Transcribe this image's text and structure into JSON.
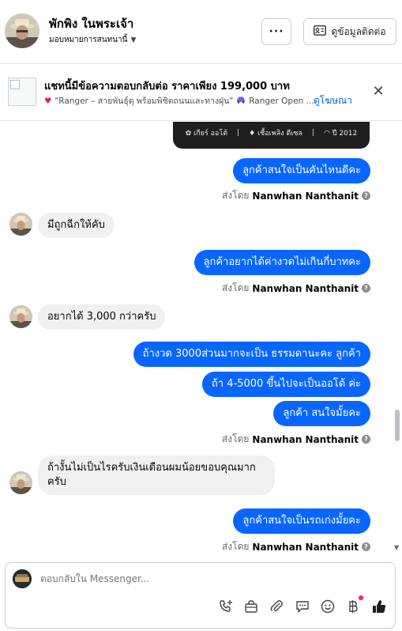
{
  "header": {
    "contact_name": "พักพิง ในพระเจ้า",
    "assign_label": "มอบหมายการสนทนานี้",
    "more_label": "···",
    "contact_info_label": "ดูข้อมูลติดต่อ"
  },
  "ad": {
    "title": "แชทนี้มีข้อความตอบกลับต่อ ราคาเพียง 199,000 บาท",
    "subtitle_a": "\"Ranger – สายพันธุ์ดุ พร้อมพิชิตถนนและทางฝุ่น\"",
    "subtitle_b": "Ranger Open ...",
    "view_ad": "ดูโฆษณา",
    "close": "✕"
  },
  "card": {
    "gear": "เกียร์ ออโต้",
    "fuel": "เชื้อเพลิง ดีเซล",
    "year": "ปี 2012"
  },
  "messages": {
    "m1": "ลูกค้าสนใจเป็นคันไหนดีคะ",
    "m2": "มีถูกฉีกให้คับ",
    "m3": "ลูกค้าอยากได้ค่างวดไม่เกินกี่บาทคะ",
    "m4": "อยากได้ 3,000 กว่าครับ",
    "m5": "ถ้างวด 3000ส่วนมากจะเป็น ธรรมดานะคะ  ลูกค้า",
    "m6": "ถ้า 4-5000 ขึ้นไปจะเป็นออโต้ ค่ะ",
    "m7": "ลูกค้า สนใจมั้ยคะ",
    "m8_line1": "ถ้างั้นไม่เป็นไรครับเงินเดือนผมน้อยขอบคุณมาก",
    "m8_line2": "ครับ",
    "m9": "ลูกค้าสนใจเป็นรถเก่งมั้ยคะ"
  },
  "sent_by": {
    "prefix": "ส่งโดย",
    "agent": "Nanwhan Nanthanit",
    "help": "?"
  },
  "composer": {
    "placeholder": "ตอบกลับใน Messenger..."
  },
  "colors": {
    "outgoing_bubble": "#0866ff",
    "incoming_bubble": "#f0f0f0",
    "link": "#0064d1",
    "notification": "#f02849"
  }
}
